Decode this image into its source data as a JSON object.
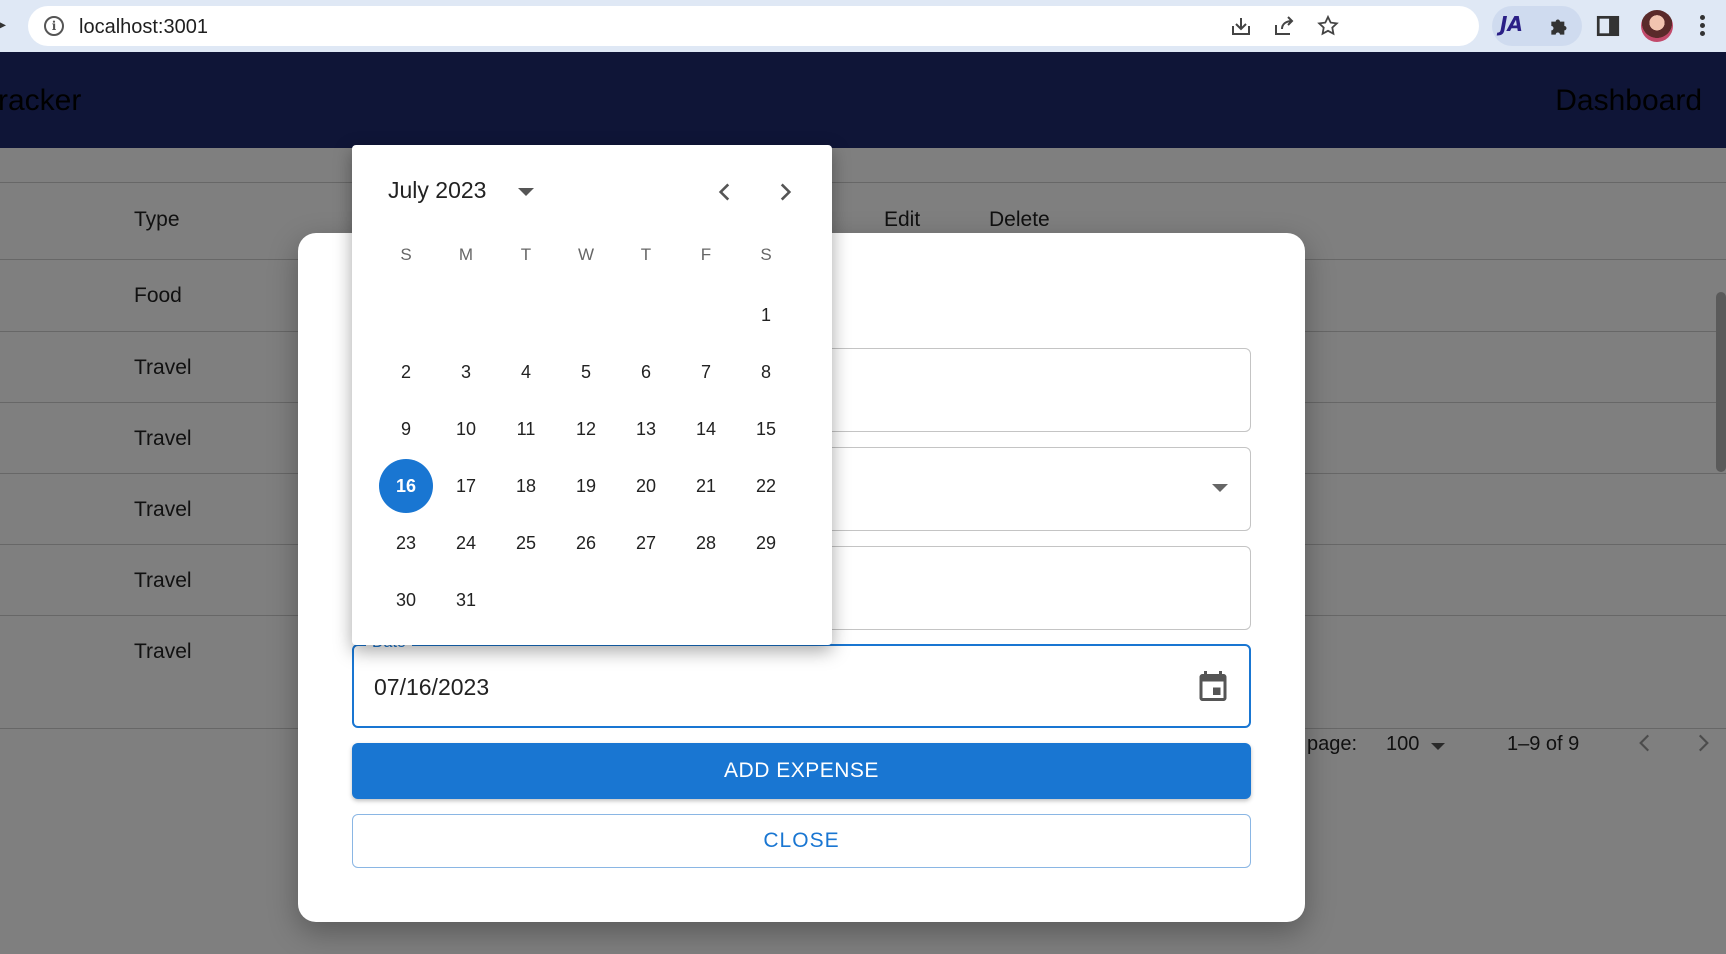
{
  "browser": {
    "url": "localhost:3001",
    "icons": [
      "info-icon",
      "install-icon",
      "share-icon",
      "star-icon",
      "ja-extension-icon",
      "puzzle-icon",
      "side-panel-icon",
      "avatar",
      "kebab-icon"
    ]
  },
  "app": {
    "brand": "racker",
    "nav_dashboard": "Dashboard",
    "table": {
      "headers": {
        "type": "Type",
        "edit": "Edit",
        "delete": "Delete"
      },
      "rows": [
        "Food",
        "Travel",
        "Travel",
        "Travel",
        "Travel",
        "Travel"
      ]
    },
    "pagination": {
      "rows_per_page_label": "page:",
      "rows_per_page": "100",
      "range": "1–9 of 9"
    }
  },
  "dialog": {
    "date_label": "Date",
    "date_value": "07/16/2023",
    "add_button": "ADD EXPENSE",
    "close_button": "CLOSE"
  },
  "datepicker": {
    "month_label": "July 2023",
    "weekdays": [
      "S",
      "M",
      "T",
      "W",
      "T",
      "F",
      "S"
    ],
    "first_weekday_index": 6,
    "days_in_month": 31,
    "selected_day": 16
  },
  "colors": {
    "primary": "#1976d2",
    "appbar": "#1f2a6e",
    "chrome": "#dfe8f5"
  }
}
